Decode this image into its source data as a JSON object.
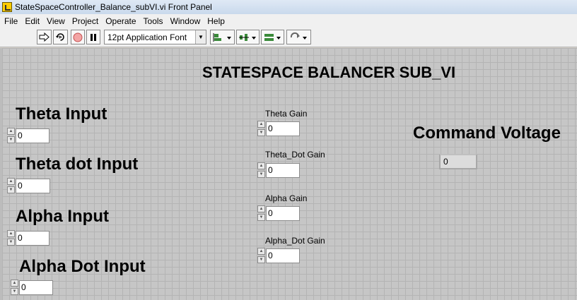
{
  "window": {
    "title": "StateSpaceController_Balance_subVI.vi Front Panel",
    "app_icon": "labview-vi-icon"
  },
  "menu": [
    "File",
    "Edit",
    "View",
    "Project",
    "Operate",
    "Tools",
    "Window",
    "Help"
  ],
  "toolbar": {
    "font_select": "12pt Application Font",
    "run_icon": "run-arrow-icon",
    "run_continuous_icon": "run-continuously-icon",
    "abort_icon": "abort-icon",
    "pause_icon": "pause-icon",
    "align_icon": "align-objects-icon",
    "distribute_icon": "distribute-objects-icon",
    "resize_icon": "resize-objects-icon",
    "reorder_icon": "reorder-icon"
  },
  "panel": {
    "title": "STATESPACE BALANCER SUB_VI",
    "inputs": [
      {
        "label": "Theta Input",
        "value": "0"
      },
      {
        "label": "Theta dot Input",
        "value": "0"
      },
      {
        "label": "Alpha Input",
        "value": "0"
      },
      {
        "label": "Alpha Dot Input",
        "value": "0"
      }
    ],
    "gains": [
      {
        "label": "Theta Gain",
        "value": "0"
      },
      {
        "label": "Theta_Dot Gain",
        "value": "0"
      },
      {
        "label": "Alpha Gain",
        "value": "0"
      },
      {
        "label": "Alpha_Dot Gain",
        "value": "0"
      }
    ],
    "output": {
      "label": "Command Voltage",
      "value": "0"
    }
  },
  "colors": {
    "panel_bg": "#c6c6c6",
    "grid": "#b4b4b4"
  }
}
